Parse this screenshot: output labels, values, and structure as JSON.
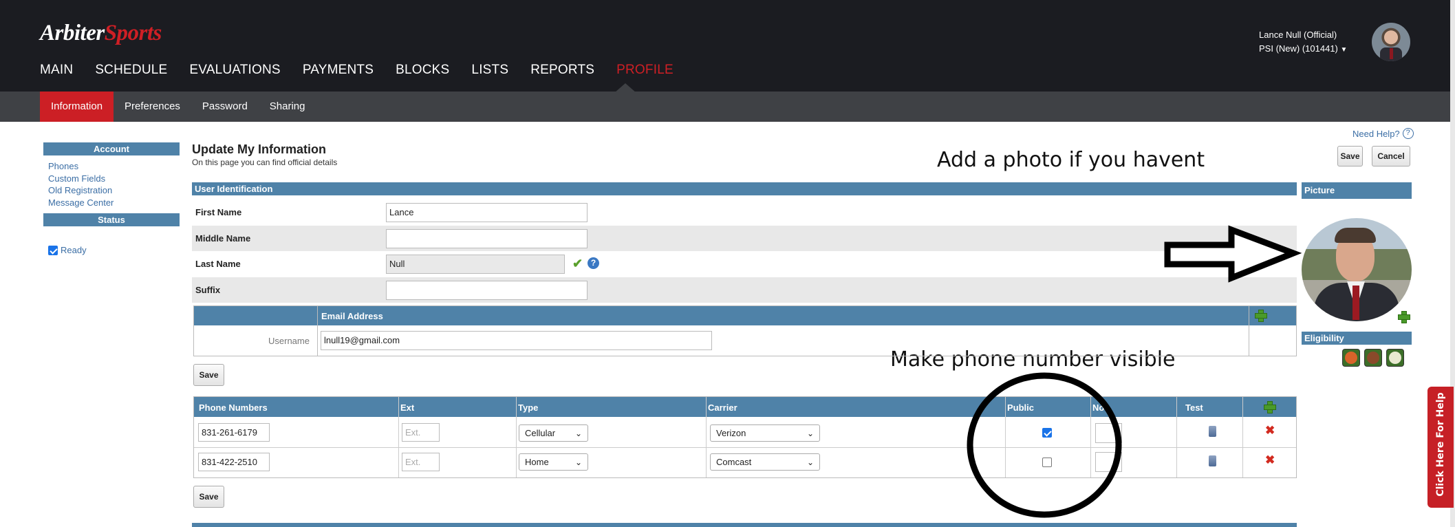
{
  "brand": {
    "part1": "Arbiter",
    "part2": "Sports"
  },
  "main_nav": [
    "MAIN",
    "SCHEDULE",
    "EVALUATIONS",
    "PAYMENTS",
    "BLOCKS",
    "LISTS",
    "REPORTS",
    "PROFILE"
  ],
  "main_nav_active": "PROFILE",
  "user": {
    "name": "Lance Null (Official)",
    "group": "PSI (New) (101441)"
  },
  "sub_nav": [
    "Information",
    "Preferences",
    "Password",
    "Sharing"
  ],
  "sidebar": {
    "account_header": "Account",
    "links": [
      "Phones",
      "Custom Fields",
      "Old Registration",
      "Message Center"
    ],
    "status_header": "Status",
    "status_ready": "Ready"
  },
  "form": {
    "title": "Update My Information",
    "subtitle": "On this page you can find official details",
    "need_help": "Need Help?",
    "save": "Save",
    "cancel": "Cancel"
  },
  "annotations": {
    "photo": "Add a photo if you havent",
    "phone": "Make phone number visible"
  },
  "user_identification": {
    "header": "User Identification",
    "first_name_label": "First Name",
    "first_name": "Lance",
    "middle_name_label": "Middle Name",
    "middle_name": "",
    "last_name_label": "Last Name",
    "last_name": "Null",
    "suffix_label": "Suffix",
    "suffix": ""
  },
  "email": {
    "header": "Email Address",
    "username_label": "Username",
    "value": "lnull19@gmail.com",
    "save": "Save"
  },
  "phones": {
    "headers": [
      "Phone Numbers",
      "Ext",
      "Type",
      "Carrier",
      "Public",
      "No",
      "Test"
    ],
    "ext_placeholder": "Ext.",
    "rows": [
      {
        "number": "831-261-6179",
        "type": "Cellular",
        "carrier": "Verizon",
        "public": true
      },
      {
        "number": "831-422-2510",
        "type": "Home",
        "carrier": "Comcast",
        "public": false
      }
    ],
    "save": "Save"
  },
  "picture": {
    "header": "Picture"
  },
  "eligibility": {
    "header": "Eligibility"
  },
  "help_tab": "Click Here For Help",
  "colors": {
    "brand_red": "#cc1f25",
    "header_blue": "#4f82a8",
    "topbar": "#1b1c21",
    "subbar": "#3f4145"
  }
}
